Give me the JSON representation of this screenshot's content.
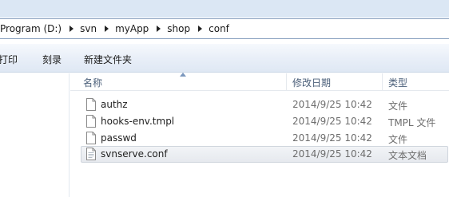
{
  "address_bar": {
    "crumbs": [
      "Program (D:)",
      "svn",
      "myApp",
      "shop",
      "conf"
    ]
  },
  "toolbar": {
    "print_label": "打印",
    "burn_label": "刻录",
    "new_folder_label": "新建文件夹"
  },
  "columns": {
    "name": "名称",
    "date": "修改日期",
    "type": "类型"
  },
  "files": [
    {
      "name": "authz",
      "date": "2014/9/25 10:42",
      "type": "文件",
      "icon": "file-icon",
      "selected": false
    },
    {
      "name": "hooks-env.tmpl",
      "date": "2014/9/25 10:42",
      "type": "TMPL 文件",
      "icon": "file-icon",
      "selected": false
    },
    {
      "name": "passwd",
      "date": "2014/9/25 10:42",
      "type": "文件",
      "icon": "file-icon",
      "selected": false
    },
    {
      "name": "svnserve.conf",
      "date": "2014/9/25 10:42",
      "type": "文本文档",
      "icon": "text-file-icon",
      "selected": true
    }
  ],
  "colors": {
    "header_text": "#4c607a",
    "toolbar_bg": "#e9eff8",
    "selection_bg": "#e6e9ee",
    "address_border": "#8aa2c0"
  }
}
